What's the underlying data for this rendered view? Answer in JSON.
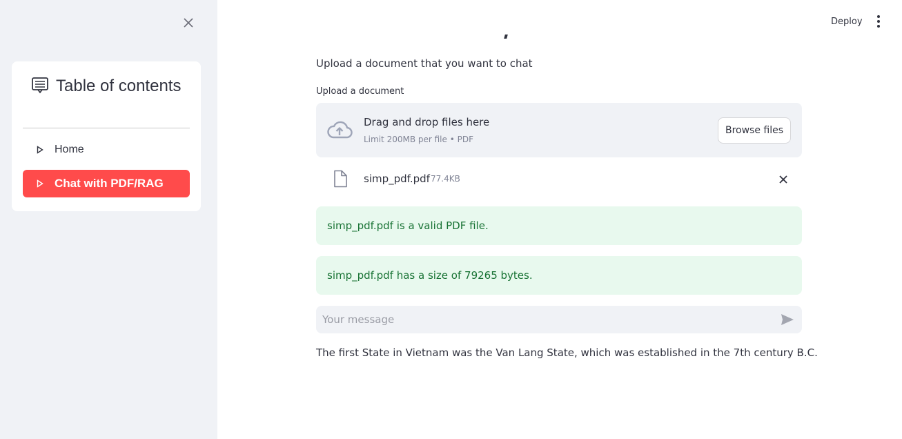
{
  "header": {
    "deploy_label": "Deploy",
    "menu_icon": "more-vertical-icon"
  },
  "sidebar": {
    "close_icon": "close-icon",
    "toc": {
      "title": "Table of contents",
      "icon": "list-doc-icon",
      "items": [
        {
          "label": "Home",
          "active": false
        },
        {
          "label": "Chat with PDF/RAG",
          "active": true
        }
      ]
    }
  },
  "main": {
    "subtitle": "Upload a document that you want to chat",
    "uploader": {
      "label": "Upload a document",
      "drop_text": "Drag and drop files here",
      "limit_text": "Limit 200MB per file • PDF",
      "browse_label": "Browse files"
    },
    "file": {
      "name": "simp_pdf.pdf",
      "size": "77.4KB"
    },
    "alerts": [
      "simp_pdf.pdf is a valid PDF file.",
      "simp_pdf.pdf has a size of 79265 bytes."
    ],
    "chat": {
      "placeholder": "Your message"
    },
    "answer": "The first State in Vietnam was the Van Lang State, which was established in the 7th century B.C."
  },
  "colors": {
    "accent": "#ff4b4b",
    "sidebar_bg": "#f0f2f6",
    "success_bg": "#e8f9ee",
    "success_text": "#177233"
  }
}
